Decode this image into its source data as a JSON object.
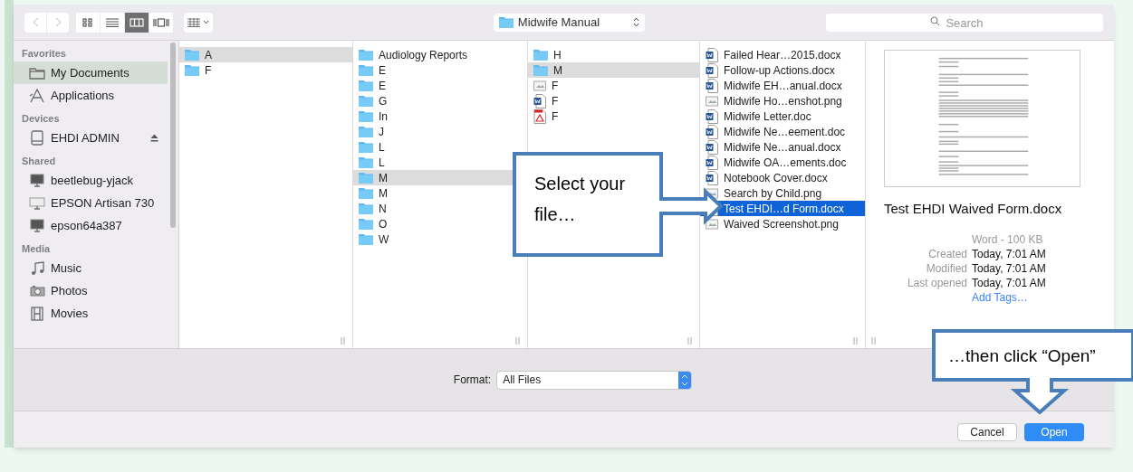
{
  "toolbar": {
    "views": [
      {
        "kind": "icons",
        "selected": false
      },
      {
        "kind": "list",
        "selected": false
      },
      {
        "kind": "columns",
        "selected": true
      },
      {
        "kind": "coverflow",
        "selected": false
      }
    ],
    "location": "Midwife Manual",
    "search": {
      "placeholder": "Search"
    }
  },
  "sidebar": [
    {
      "heading": "Favorites",
      "items": [
        {
          "label": "My Documents",
          "kind": "folder",
          "selected": true
        },
        {
          "label": "Applications",
          "kind": "apps",
          "selected": false
        }
      ]
    },
    {
      "heading": "Devices",
      "items": [
        {
          "label": "EHDI ADMIN",
          "kind": "disk",
          "selected": false,
          "eject": true
        }
      ]
    },
    {
      "heading": "Shared",
      "items": [
        {
          "label": "beetlebug-yjack",
          "kind": "monitor",
          "selected": false
        },
        {
          "label": "EPSON Artisan 730",
          "kind": "display",
          "selected": false
        },
        {
          "label": "epson64a387",
          "kind": "monitor",
          "selected": false
        }
      ]
    },
    {
      "heading": "Media",
      "items": [
        {
          "label": "Music",
          "kind": "music",
          "selected": false
        },
        {
          "label": "Photos",
          "kind": "camera",
          "selected": false
        },
        {
          "label": "Movies",
          "kind": "film",
          "selected": false
        }
      ]
    }
  ],
  "columns": [
    {
      "focused": false,
      "items": [
        {
          "name": "A",
          "kind": "folder",
          "selected": true
        },
        {
          "name": "F",
          "kind": "folder",
          "selected": false
        }
      ]
    },
    {
      "focused": false,
      "items": [
        {
          "name": "Audiology Reports",
          "kind": "folder",
          "selected": false
        },
        {
          "name": "E",
          "kind": "folder",
          "selected": false
        },
        {
          "name": "E",
          "kind": "folder",
          "selected": false
        },
        {
          "name": "G",
          "kind": "folder",
          "selected": false
        },
        {
          "name": "In",
          "kind": "folder",
          "selected": false
        },
        {
          "name": "J",
          "kind": "folder",
          "selected": false
        },
        {
          "name": "L",
          "kind": "folder",
          "selected": false
        },
        {
          "name": "L",
          "kind": "folder",
          "selected": false
        },
        {
          "name": "M",
          "kind": "folder",
          "selected": true
        },
        {
          "name": "M",
          "kind": "folder",
          "selected": false
        },
        {
          "name": "N",
          "kind": "folder",
          "selected": false
        },
        {
          "name": "O",
          "kind": "folder",
          "selected": false
        },
        {
          "name": "W",
          "kind": "folder",
          "selected": false
        }
      ]
    },
    {
      "focused": false,
      "items": [
        {
          "name": "H",
          "kind": "folder",
          "selected": false
        },
        {
          "name": "M",
          "kind": "folder",
          "selected": true
        },
        {
          "name": "F",
          "kind": "image",
          "selected": false
        },
        {
          "name": "F",
          "kind": "word",
          "selected": false
        },
        {
          "name": "F",
          "kind": "pdf",
          "selected": false
        }
      ]
    },
    {
      "focused": true,
      "items": [
        {
          "name": "Failed Hear…2015.docx",
          "kind": "word",
          "selected": false
        },
        {
          "name": "Follow-up Actions.docx",
          "kind": "word",
          "selected": false
        },
        {
          "name": "Midwife EH…anual.docx",
          "kind": "word",
          "selected": false
        },
        {
          "name": "Midwife Ho…enshot.png",
          "kind": "image",
          "selected": false
        },
        {
          "name": "Midwife Letter.doc",
          "kind": "word",
          "selected": false
        },
        {
          "name": "Midwife Ne…eement.doc",
          "kind": "word",
          "selected": false
        },
        {
          "name": "Midwife Ne…anual.docx",
          "kind": "word",
          "selected": false
        },
        {
          "name": "Midwife OA…ements.doc",
          "kind": "word",
          "selected": false
        },
        {
          "name": "Notebook Cover.docx",
          "kind": "word",
          "selected": false
        },
        {
          "name": "Search by Child.png",
          "kind": "image",
          "selected": false
        },
        {
          "name": "Test EHDI…d Form.docx",
          "kind": "word",
          "selected": true
        },
        {
          "name": "Waived Screenshot.png",
          "kind": "image",
          "selected": false
        }
      ]
    }
  ],
  "preview": {
    "name": "Test EHDI Waived Form.docx",
    "kind_size": "Word - 100 KB",
    "details": [
      {
        "label": "Created",
        "value": "Today, 7:01 AM"
      },
      {
        "label": "Modified",
        "value": "Today, 7:01 AM"
      },
      {
        "label": "Last opened",
        "value": "Today, 7:01 AM"
      }
    ],
    "tags_link": "Add Tags…"
  },
  "format": {
    "label": "Format:",
    "value": "All Files"
  },
  "buttons": [
    {
      "label": "Cancel",
      "default": false
    },
    {
      "label": "Open",
      "default": true
    }
  ],
  "callouts": [
    {
      "text": "Select your file…",
      "kind": "right"
    },
    {
      "text": "…then click “Open”",
      "kind": "down"
    }
  ]
}
